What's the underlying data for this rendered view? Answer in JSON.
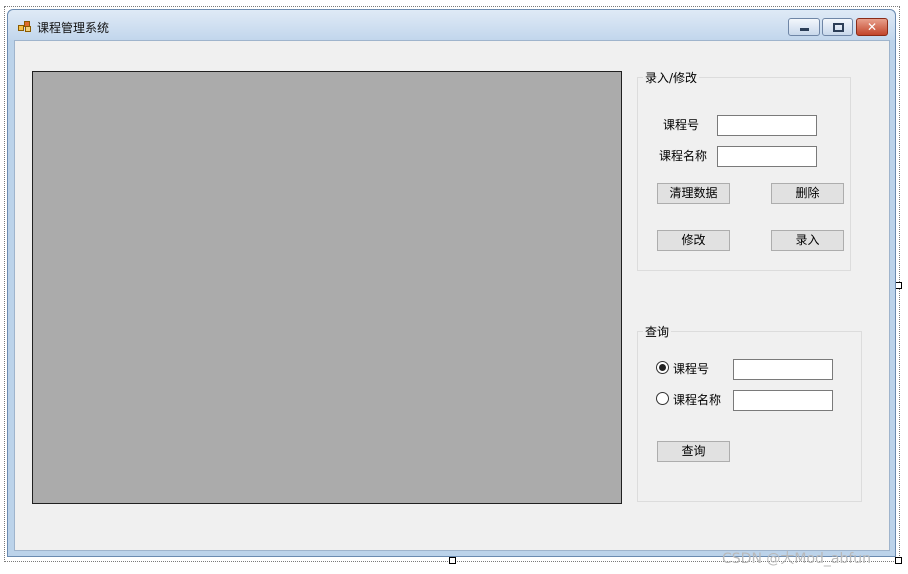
{
  "window": {
    "title": "课程管理系统",
    "controls": [
      "minimize-icon",
      "maximize-icon",
      "close-icon"
    ],
    "close_glyph": "✕"
  },
  "edit_group": {
    "title": "录入/修改",
    "course_id_label": "课程号",
    "course_id_value": "",
    "course_name_label": "课程名称",
    "course_name_value": "",
    "clear_button": "清理数据",
    "delete_button": "删除",
    "modify_button": "修改",
    "add_button": "录入"
  },
  "query_group": {
    "title": "查询",
    "radio_course_id_label": "课程号",
    "radio_course_id_checked": true,
    "course_id_value": "",
    "radio_course_name_label": "课程名称",
    "radio_course_name_checked": false,
    "course_name_value": "",
    "query_button": "查询"
  },
  "watermark": "CSDN @大Mod_abfun",
  "colors": {
    "grid_background": "#ababab",
    "client_background": "#f0f0f0",
    "close_button": "#c2452b"
  }
}
